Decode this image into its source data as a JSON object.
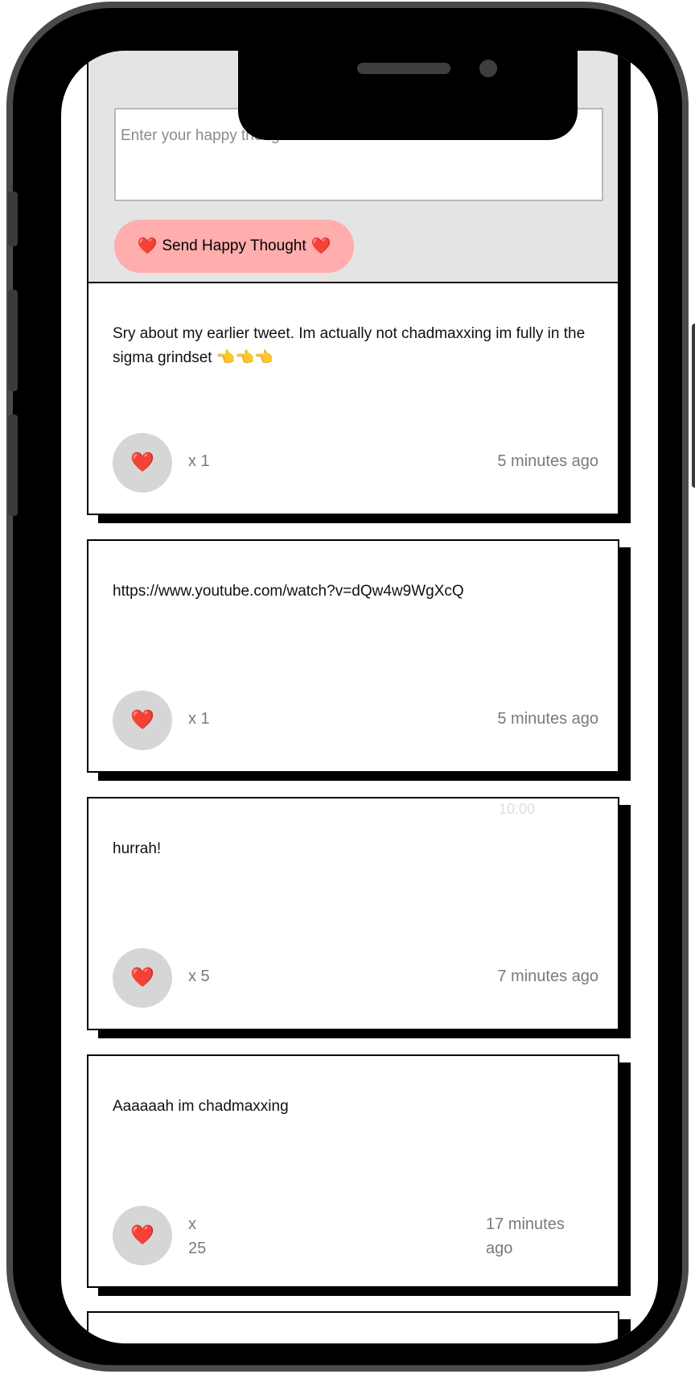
{
  "form": {
    "placeholder": "Enter your happy thought here..",
    "button_label": "Send Happy Thought"
  },
  "status_bar": {
    "time": "10:00"
  },
  "messages": [
    {
      "text": "Sry about my earlier tweet. Im actually not chadmaxxing im fully in the sigma grindset 👈👈👈",
      "likes": "x 1",
      "time": "5 minutes ago"
    },
    {
      "text": "https://www.youtube.com/watch?v=dQw4w9WgXcQ",
      "likes": "x 1",
      "time": "5 minutes ago"
    },
    {
      "text": "hurrah!",
      "likes": "x 5",
      "time": "7 minutes ago"
    },
    {
      "text": "Aaaaaah im chadmaxxing",
      "likes": "x 25",
      "time": "17 minutes ago"
    }
  ],
  "icons": {
    "like": "heart-icon",
    "button": "heart-icon"
  },
  "colors": {
    "button_bg": "#ffadad",
    "like_bg": "#d6d6d6",
    "form_bg": "#e4e4e4",
    "heart": "#e3182d"
  }
}
